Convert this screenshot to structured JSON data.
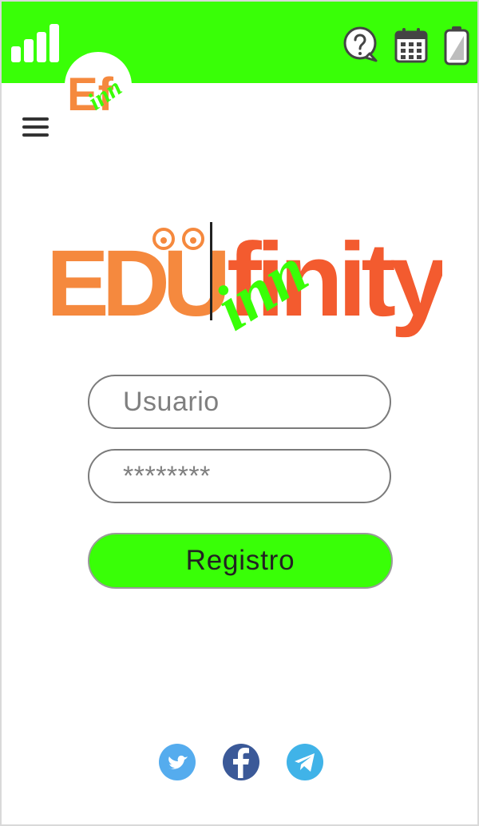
{
  "status_bar": {
    "signal_icon": "signal-bars-icon",
    "help_icon": "help-bubble-icon",
    "calendar_icon": "calendar-icon",
    "battery_icon": "battery-icon",
    "accent_color": "#39ff07"
  },
  "brand": {
    "small_logo_text": "Ef",
    "small_logo_script": "inn",
    "hero_left": "EDU",
    "hero_script": "inn",
    "hero_right": "finity",
    "colors": {
      "orange": "#f5893e",
      "red": "#f35b2f",
      "green": "#39ff07",
      "blue": "#4b97d3"
    }
  },
  "form": {
    "username_placeholder": "Usuario",
    "password_placeholder": "********",
    "register_label": "Registro"
  },
  "social": [
    {
      "name": "twitter-icon",
      "color": "#55acee"
    },
    {
      "name": "facebook-icon",
      "color": "#3b5998"
    },
    {
      "name": "telegram-icon",
      "color": "#40b3e8"
    }
  ]
}
